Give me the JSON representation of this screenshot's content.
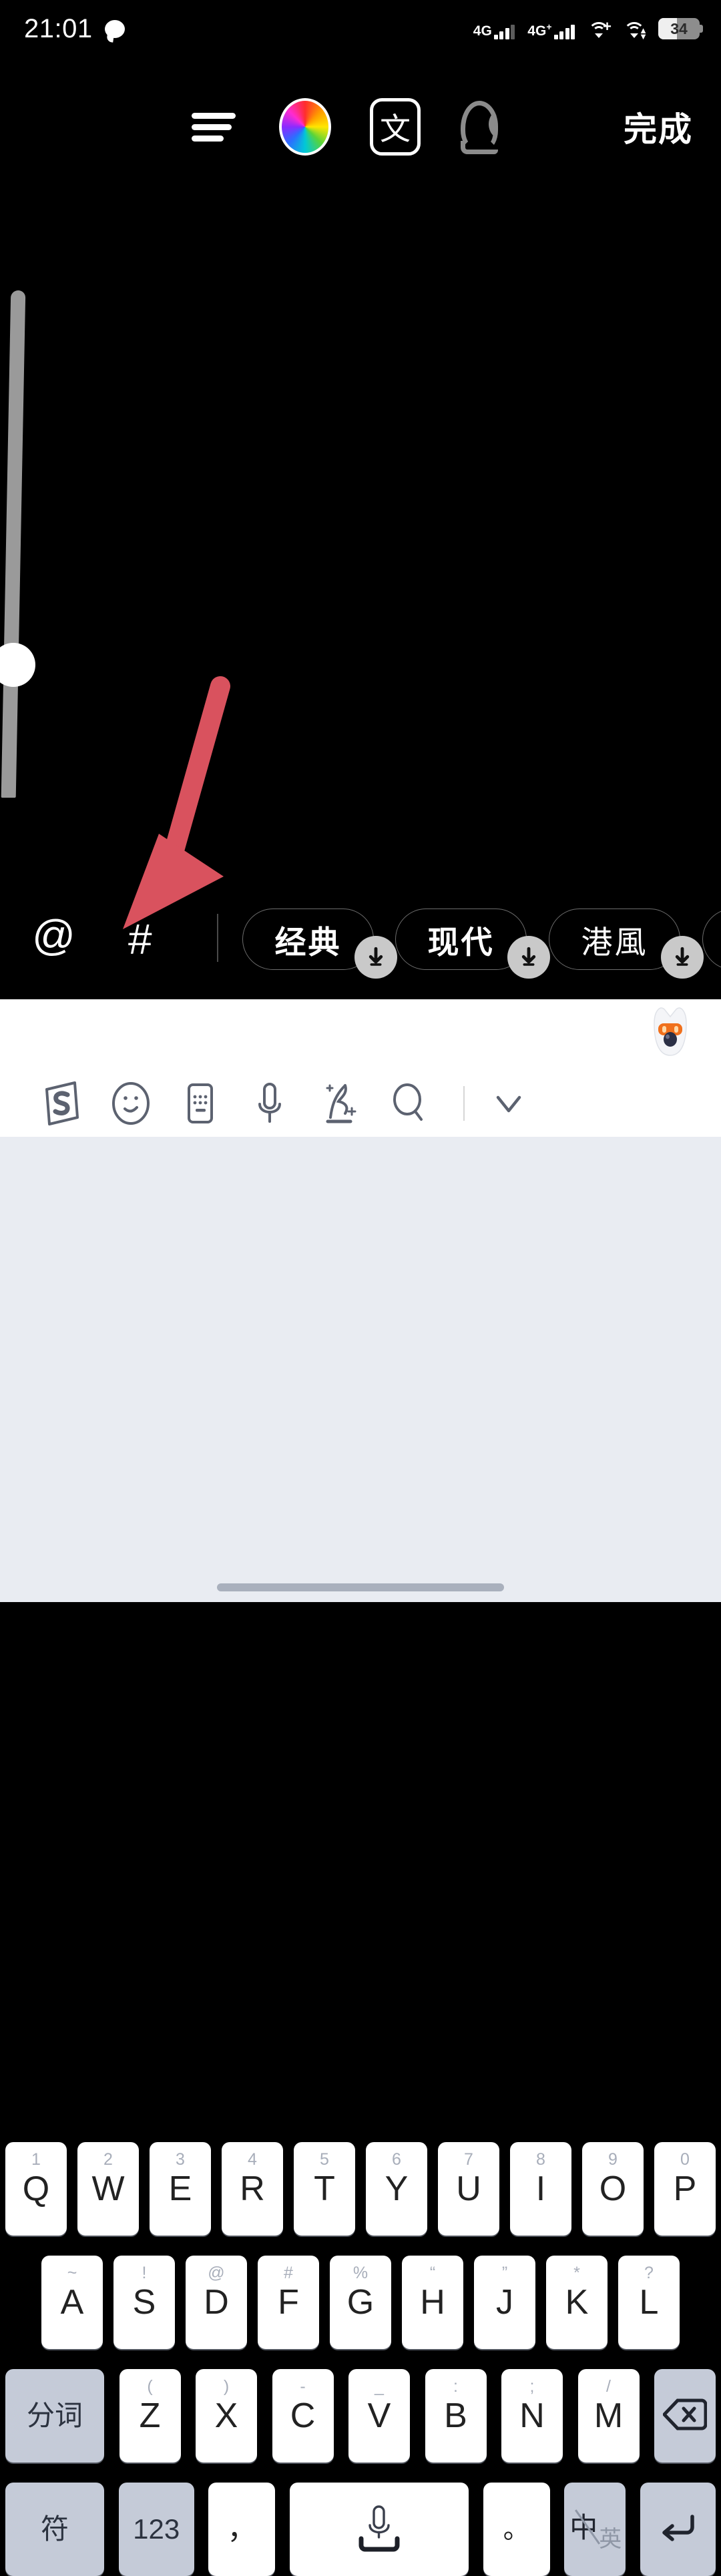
{
  "status_bar": {
    "time": "21:01",
    "notification_icon": "chat-bubble-icon",
    "signal_1_label": "4G",
    "signal_2_label": "4G",
    "signal_2_plus": "+",
    "wifi_1_icon": "wifi-plus-icon",
    "wifi_2_icon": "wifi-transfer-icon",
    "battery_percent": "34"
  },
  "toolbar": {
    "align_icon": "text-align-icon",
    "color_icon": "color-wheel-icon",
    "font_label": "文",
    "speak_icon": "text-to-speech-icon",
    "done_label": "完成"
  },
  "editor": {
    "size_slider_icon": "vertical-size-slider",
    "annotation_arrow_color": "#d9525e"
  },
  "chip_bar": {
    "mention_label": "@",
    "hashtag_label": "#",
    "chips": [
      {
        "label": "经典",
        "serif": false,
        "download_icon": "download-icon"
      },
      {
        "label": "现代",
        "serif": false,
        "download_icon": "download-icon"
      },
      {
        "label": "港風",
        "serif": true,
        "download_icon": "download-icon"
      },
      {
        "label": "",
        "serif": false,
        "download_icon": "download-icon"
      }
    ]
  },
  "keyboard": {
    "mascot_icon": "sogou-mascot-avatar",
    "tools": [
      "sogou-logo-icon",
      "emoji-icon",
      "keyboard-layout-icon",
      "microphone-icon",
      "handwriting-icon",
      "search-icon",
      "chevron-down-icon"
    ],
    "row1": [
      {
        "sup": "1",
        "main": "Q"
      },
      {
        "sup": "2",
        "main": "W"
      },
      {
        "sup": "3",
        "main": "E"
      },
      {
        "sup": "4",
        "main": "R"
      },
      {
        "sup": "5",
        "main": "T"
      },
      {
        "sup": "6",
        "main": "Y"
      },
      {
        "sup": "7",
        "main": "U"
      },
      {
        "sup": "8",
        "main": "I"
      },
      {
        "sup": "9",
        "main": "O"
      },
      {
        "sup": "0",
        "main": "P"
      }
    ],
    "row2": [
      {
        "sup": "~",
        "main": "A"
      },
      {
        "sup": "!",
        "main": "S"
      },
      {
        "sup": "@",
        "main": "D"
      },
      {
        "sup": "#",
        "main": "F"
      },
      {
        "sup": "%",
        "main": "G"
      },
      {
        "sup": "“",
        "main": "H"
      },
      {
        "sup": "”",
        "main": "J"
      },
      {
        "sup": "*",
        "main": "K"
      },
      {
        "sup": "?",
        "main": "L"
      }
    ],
    "row3": [
      {
        "sup": "",
        "main": "分词",
        "fn": true
      },
      {
        "sup": "(",
        "main": "Z"
      },
      {
        "sup": ")",
        "main": "X"
      },
      {
        "sup": "-",
        "main": "C"
      },
      {
        "sup": "_",
        "main": "V"
      },
      {
        "sup": ":",
        "main": "B"
      },
      {
        "sup": ";",
        "main": "N"
      },
      {
        "sup": "/",
        "main": "M"
      },
      {
        "sup": "",
        "main": "",
        "fn": true,
        "icon": "backspace-icon"
      }
    ],
    "row4": {
      "symbol_label": "符",
      "numbers_label": "123",
      "comma_label": "，",
      "space_icon": "microphone-space-icon",
      "period_label": "。",
      "lang_primary": "中",
      "lang_secondary": "英",
      "enter_icon": "enter-icon"
    }
  }
}
